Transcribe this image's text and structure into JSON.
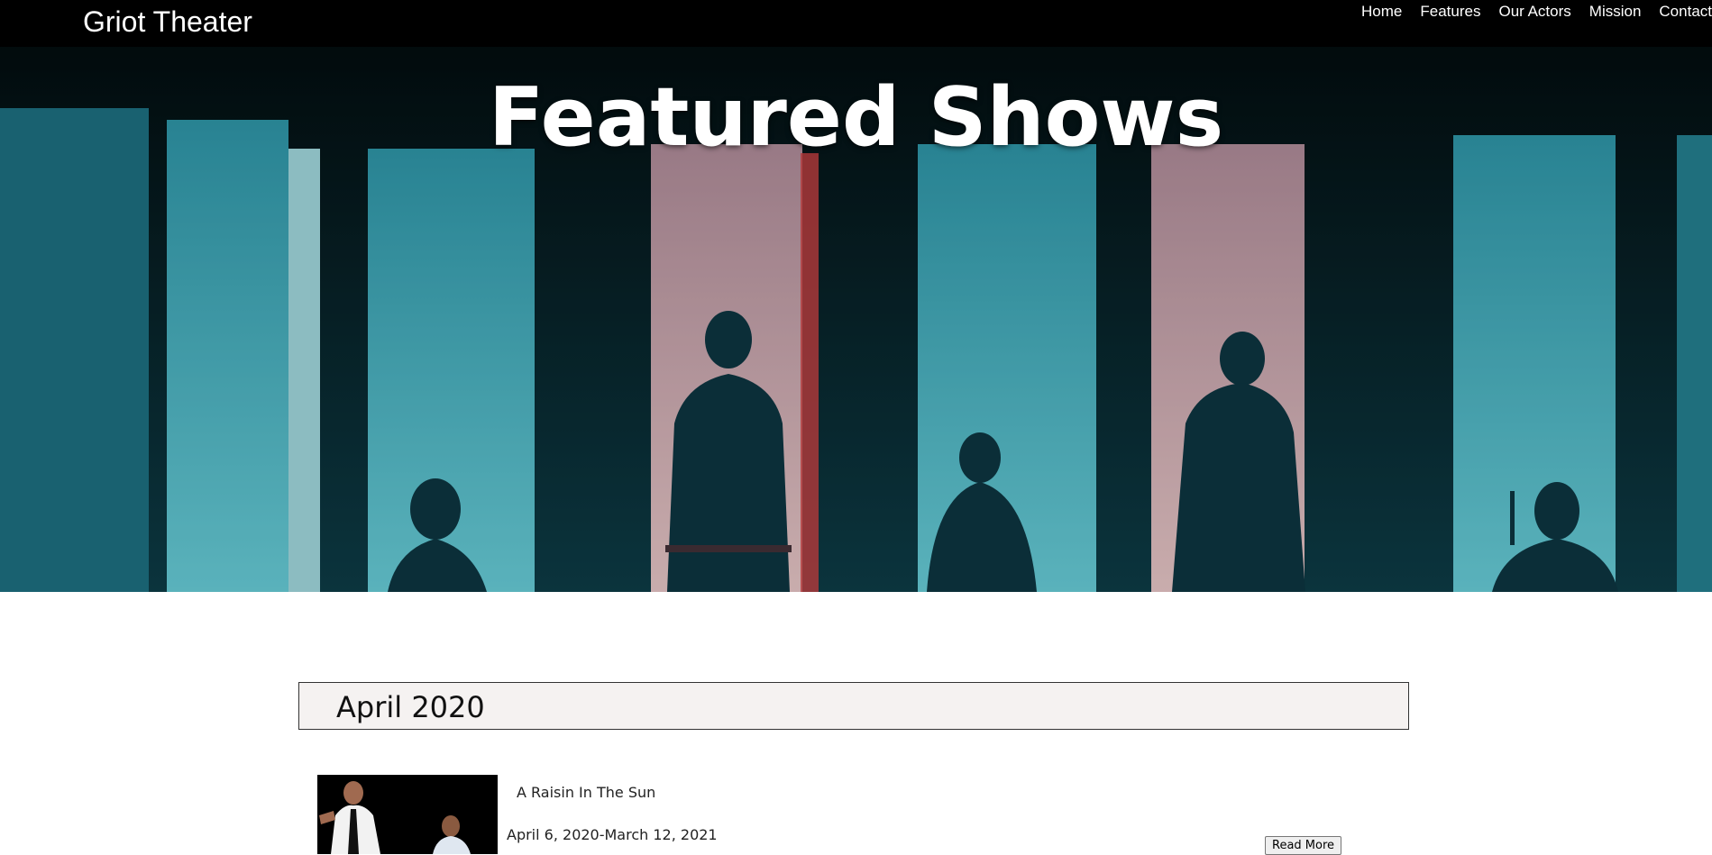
{
  "nav": {
    "brand": "Griot Theater",
    "links": [
      "Home",
      "Features",
      "Our Actors",
      "Mission",
      "Contact"
    ]
  },
  "hero": {
    "title": "Featured Shows"
  },
  "schedule": {
    "month": "April 2020",
    "shows": [
      {
        "title": "A Raisin In The Sun",
        "dates": "April 6, 2020-March 12, 2021",
        "button_label": "Read More"
      }
    ]
  },
  "colors": {
    "nav_bg": "#000000",
    "stage_cyan": "#3fb2c0",
    "stage_pink": "#d6a2a4",
    "month_bar_bg": "#f5f2f1"
  }
}
